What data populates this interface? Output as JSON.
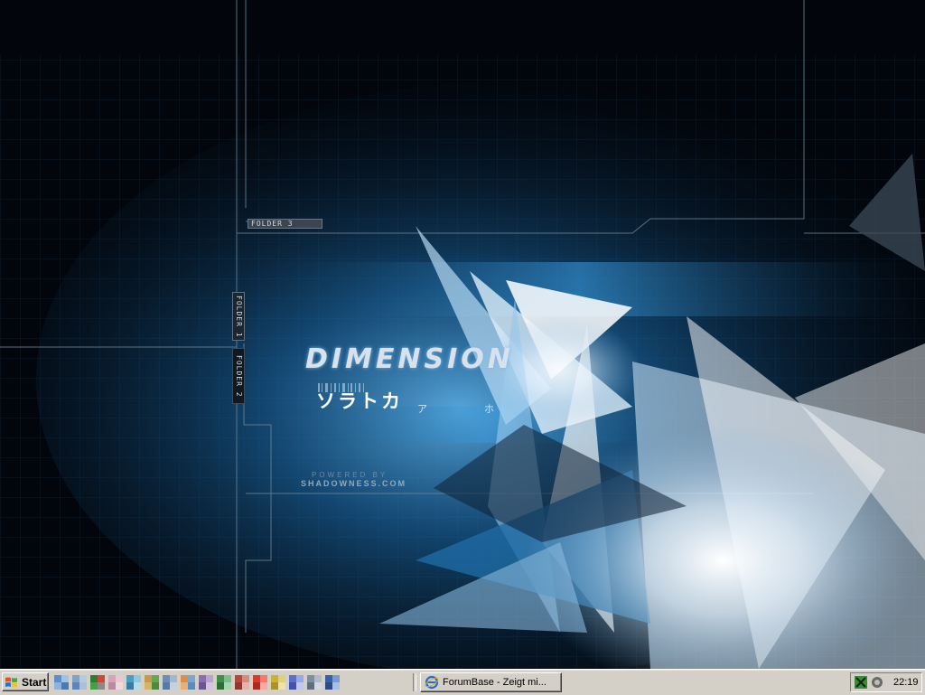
{
  "desktop": {
    "wallpaper": {
      "brand": "DIMENSION",
      "katakana": "ソラトカ",
      "katakana_small": "ア ホ",
      "powered_by": "POWERED BY",
      "site": "SHADOWNESS.COM",
      "folder_tabs": [
        "FOLDER 3",
        "FOLDER 1",
        "FOLDER 2"
      ],
      "colors": {
        "background": "#02060c",
        "accent": "#2a8fd6",
        "glow": "#ffffff",
        "grid": "#1a2a3a"
      }
    }
  },
  "taskbar": {
    "start_label": "Start",
    "quick_launch_icons": [
      "ie-icon",
      "network-icon",
      "msn-icon",
      "media-icon",
      "app-icon-5",
      "app-icon-6",
      "app-icon-7",
      "app-icon-8",
      "app-icon-9",
      "app-icon-10",
      "app-icon-11",
      "app-icon-12",
      "app-icon-13",
      "app-icon-14",
      "app-icon-15",
      "app-icon-16",
      "app-icon-17",
      "app-icon-18",
      "app-icon-19"
    ],
    "task_buttons": [
      {
        "label": "ForumBase - Zeigt mi...",
        "icon": "ie-icon"
      }
    ],
    "tray_icons": [
      "network-tray-icon",
      "speaker-icon"
    ],
    "clock": "22:19",
    "colors": {
      "face": "#d4d0c8",
      "highlight": "#ffffff",
      "shadow": "#808080"
    }
  }
}
